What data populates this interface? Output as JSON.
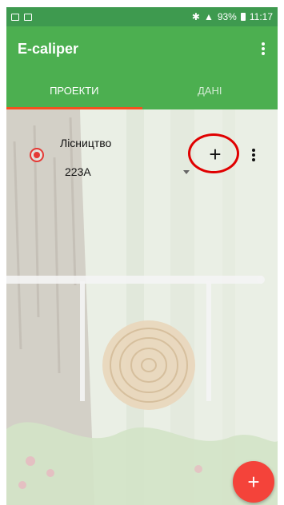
{
  "status_bar": {
    "battery": "93%",
    "time": "11:17"
  },
  "toolbar": {
    "title": "E-caliper",
    "overflow_icon": "more-vert-icon"
  },
  "tabs": [
    {
      "label": "ПРОЕКТИ",
      "active": true
    },
    {
      "label": "ДАНІ",
      "active": false
    }
  ],
  "project": {
    "label": "Лісництво",
    "selected_value": "223A"
  },
  "icons": {
    "add": "plus-icon",
    "fab": "plus-icon"
  },
  "colors": {
    "primary": "#4caf50",
    "status_bar": "#3e9a4f",
    "accent": "#f4433a",
    "tab_indicator": "#f4511e",
    "highlight_circle": "#e00000"
  }
}
